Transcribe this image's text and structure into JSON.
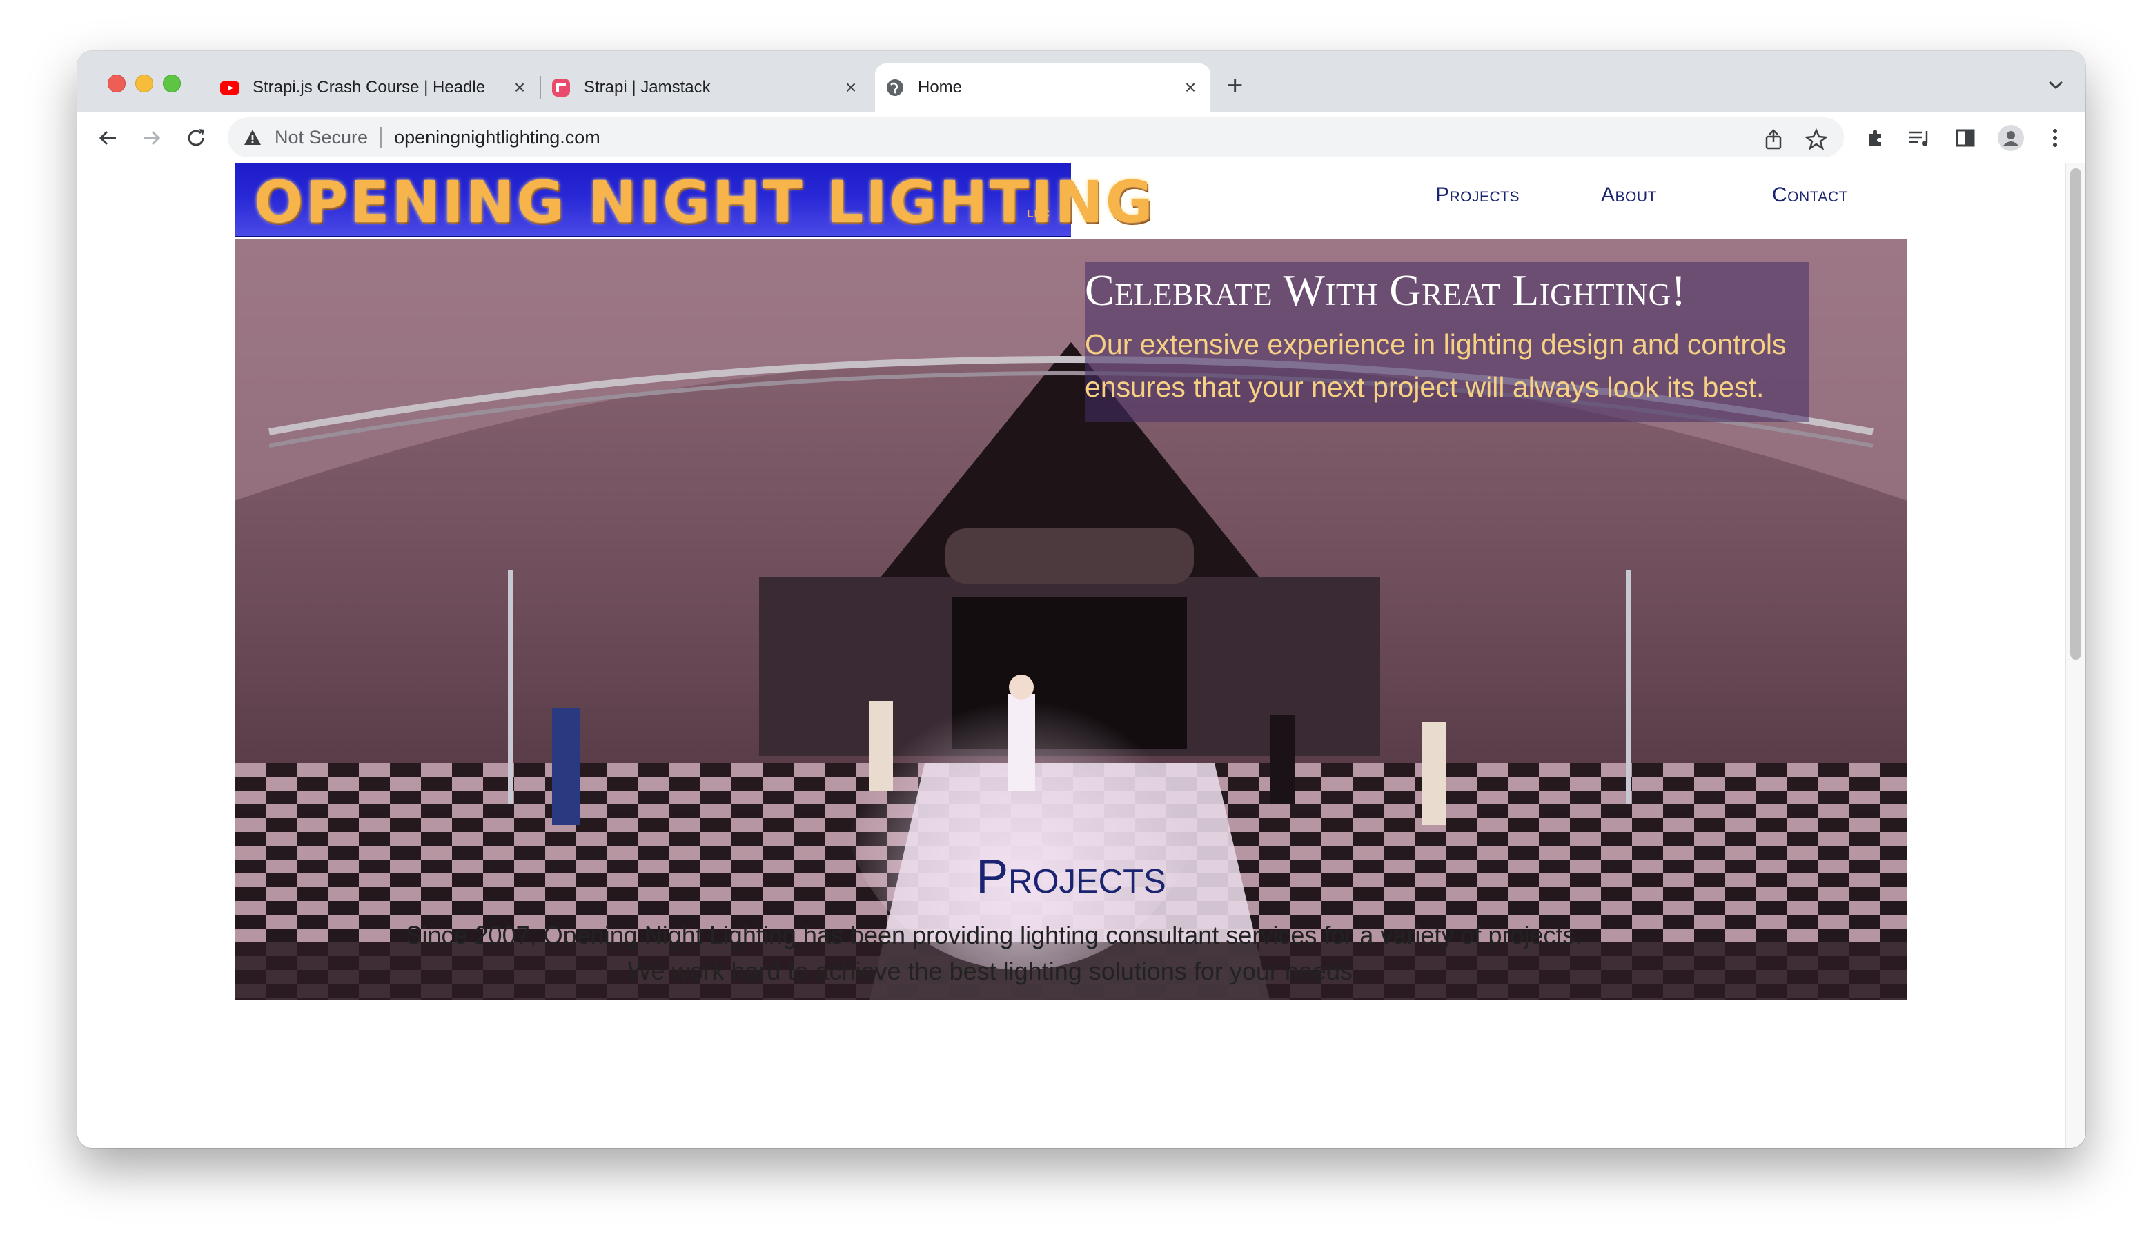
{
  "browser": {
    "tabs": [
      {
        "title": "Strapi.js Crash Course | Headle",
        "favicon": "youtube-icon",
        "active": false
      },
      {
        "title": "Strapi | Jamstack",
        "favicon": "strapi-icon",
        "active": false
      },
      {
        "title": "Home",
        "favicon": "globe-icon",
        "active": true
      }
    ],
    "new_tab_label": "+",
    "security_label": "Not Secure",
    "url": "openingnightlighting.com"
  },
  "site": {
    "logo_text": "OPENING NIGHT LIGHTING",
    "logo_suffix": "LLC",
    "nav": {
      "projects": "Projects",
      "about": "About",
      "contact": "Contact"
    },
    "hero": {
      "title": "Celebrate With Great Lighting!",
      "body": "Our extensive experience in lighting design and controls ensures that your next project will always look its best."
    },
    "projects": {
      "title": "Projects",
      "intro_line1": "Since 2007, Opening Night Lighting has been providing lighting consultant services for a variety of projects.",
      "intro_line2": "We work hard to achieve the best lighting solutions for your needs."
    }
  },
  "colors": {
    "nav_blue": "#1a2470",
    "logo_gold": "#f6b44a",
    "hero_text_gold": "#f6d184",
    "logo_blue": "#2727d6"
  }
}
